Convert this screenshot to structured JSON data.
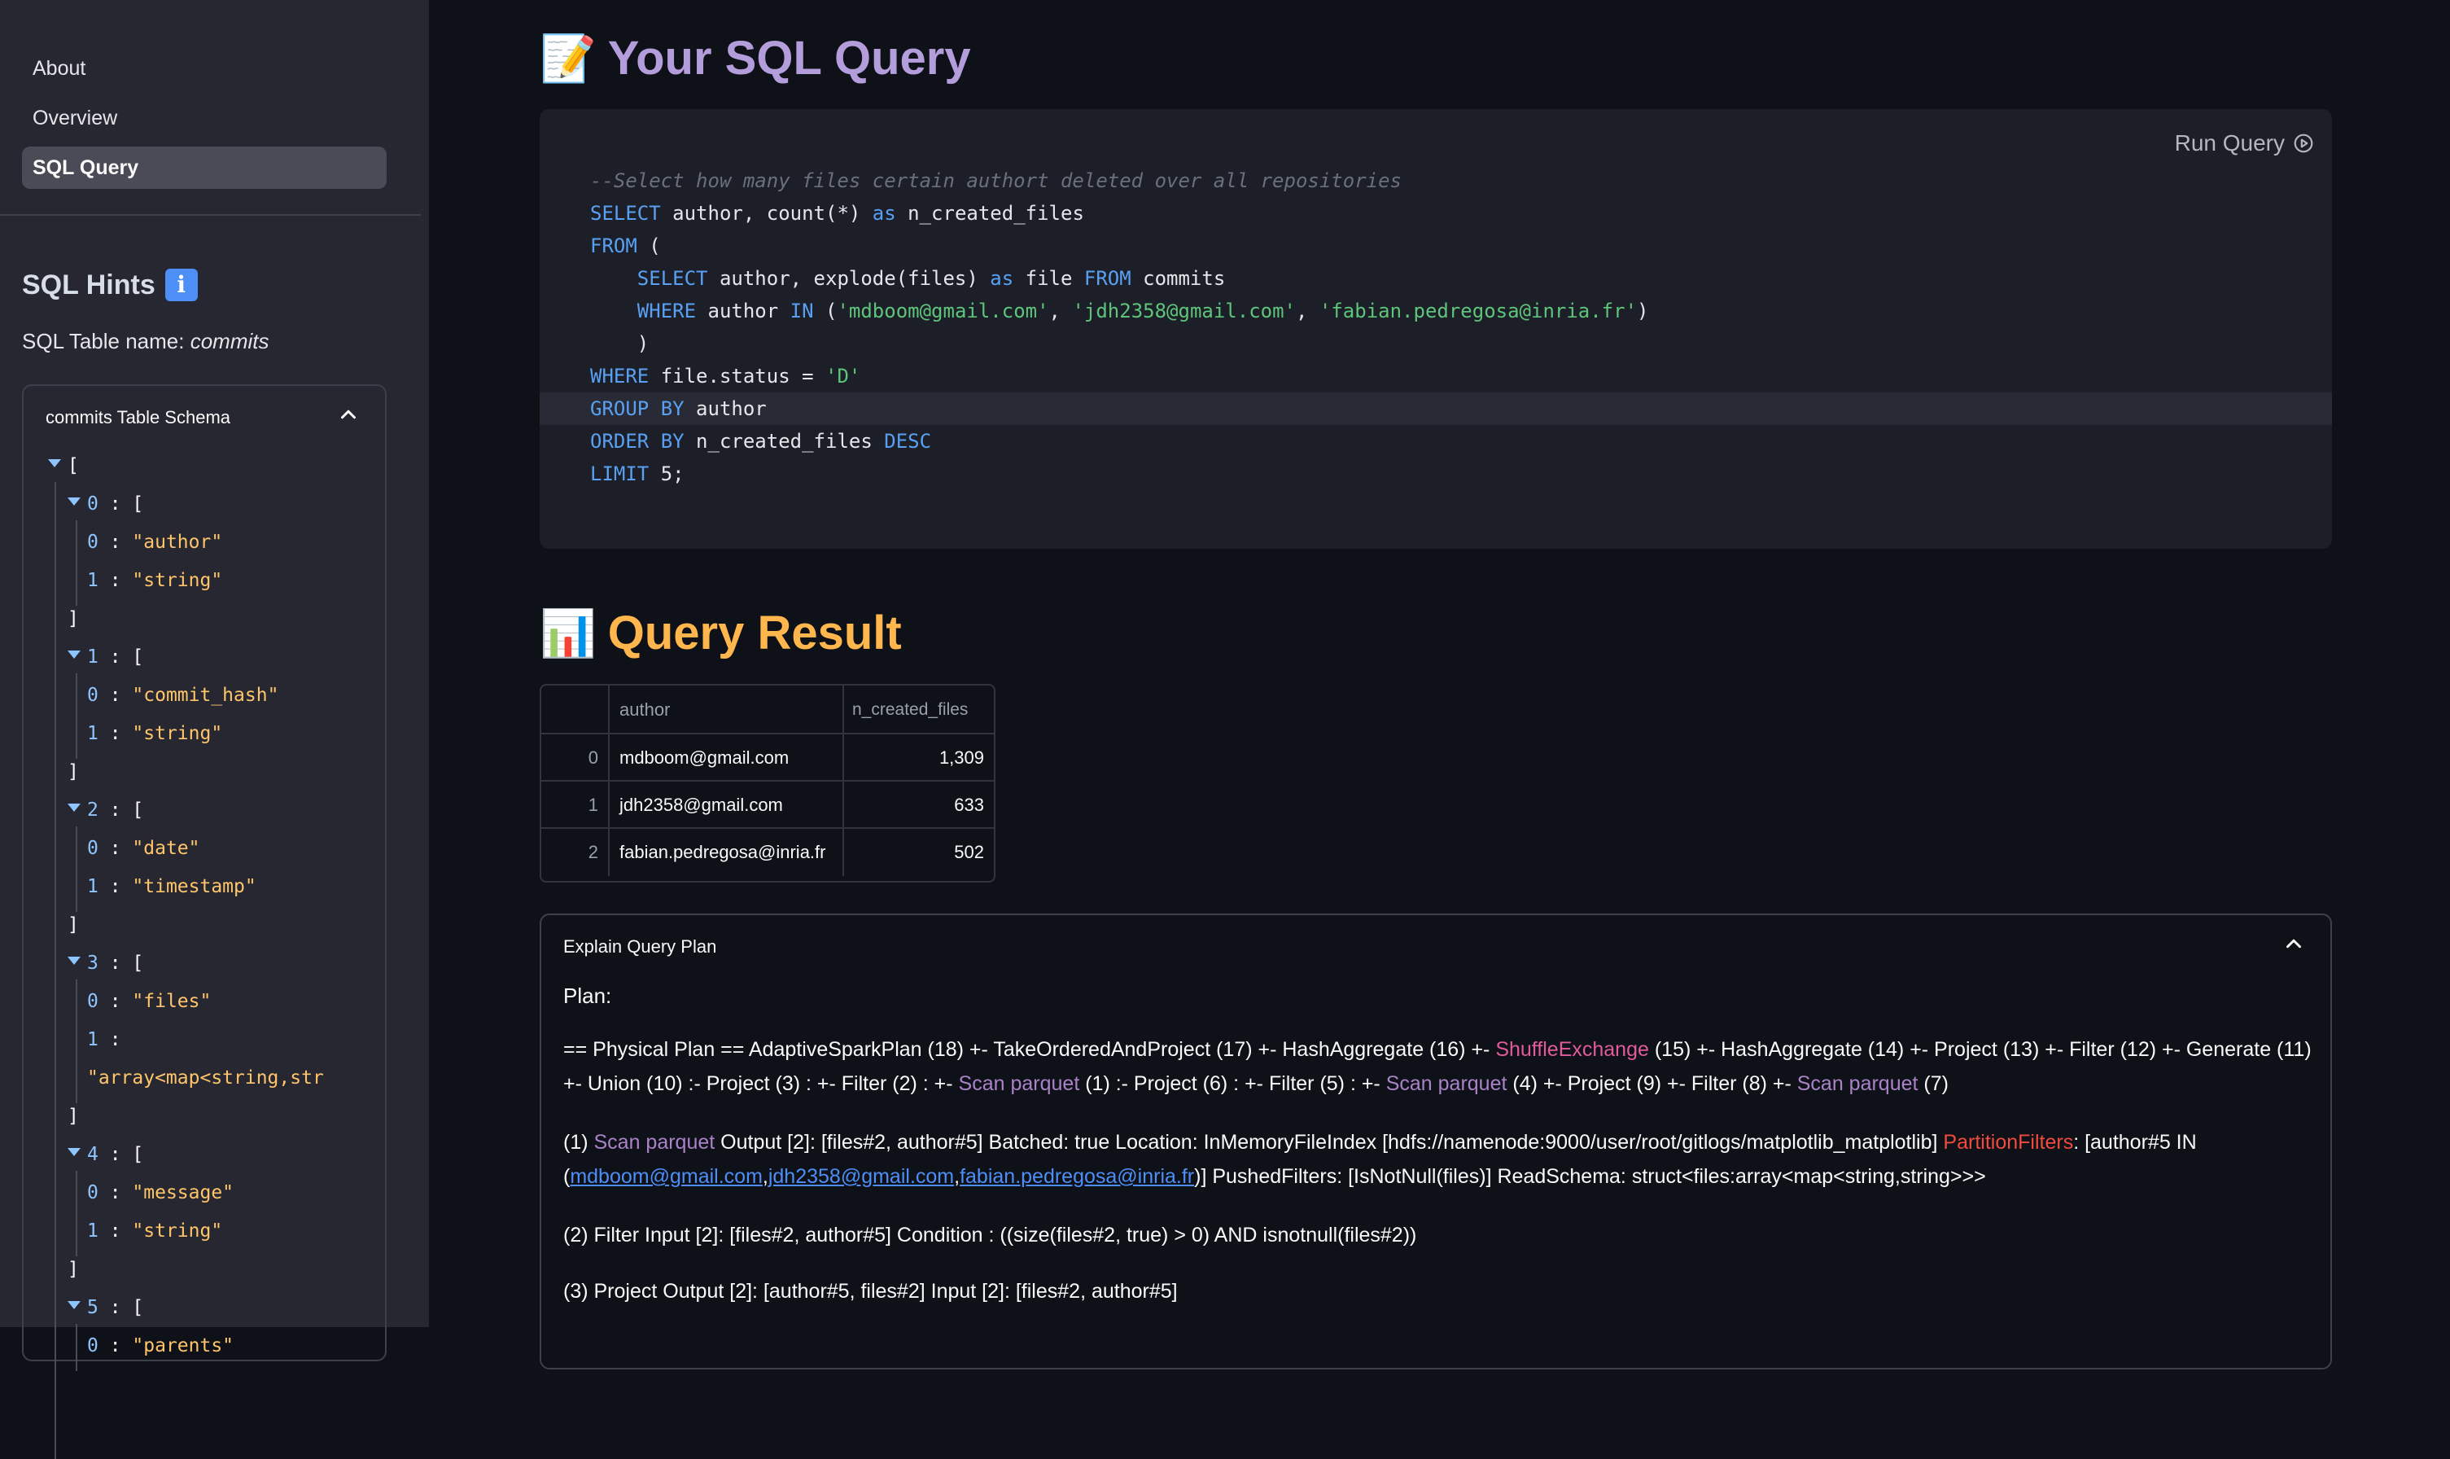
{
  "sidebar": {
    "nav": [
      "About",
      "Overview",
      "SQL Query"
    ],
    "active": "SQL Query",
    "hints_title": "SQL Hints",
    "table_name_label": "SQL Table name:",
    "table_name": "commits",
    "schema_title": "commits Table Schema",
    "schema": [
      {
        "index": "0",
        "fields": [
          "\"author\"",
          "\"string\""
        ]
      },
      {
        "index": "1",
        "fields": [
          "\"commit_hash\"",
          "\"string\""
        ]
      },
      {
        "index": "2",
        "fields": [
          "\"date\"",
          "\"timestamp\""
        ]
      },
      {
        "index": "3",
        "fields": [
          "\"files\"",
          "\"array<map<string,str"
        ]
      },
      {
        "index": "4",
        "fields": [
          "\"message\"",
          "\"string\""
        ]
      },
      {
        "index": "5",
        "fields": [
          "\"parents\""
        ]
      }
    ]
  },
  "query": {
    "title": "Your SQL Query",
    "title_emoji": "📝",
    "run_label": "Run Query",
    "comment": "--Select how many files certain authort deleted over all repositories",
    "lines": [
      "SELECT author, count(*) as n_created_files",
      "FROM (",
      "    SELECT author, explode(files) as file FROM commits",
      "    WHERE author IN ('mdboom@gmail.com', 'jdh2358@gmail.com', 'fabian.pedregosa@inria.fr')",
      "    )",
      "WHERE file.status = 'D'",
      "GROUP BY author",
      "ORDER BY n_created_files DESC",
      "LIMIT 5;"
    ]
  },
  "result": {
    "title": "Query Result",
    "title_emoji": "📊",
    "columns": [
      "author",
      "n_created_files"
    ],
    "rows": [
      {
        "idx": "0",
        "author": "mdboom@gmail.com",
        "n": "1,309"
      },
      {
        "idx": "1",
        "author": "jdh2358@gmail.com",
        "n": "633"
      },
      {
        "idx": "2",
        "author": "fabian.pedregosa@inria.fr",
        "n": "502"
      }
    ]
  },
  "explain": {
    "title": "Explain Query Plan",
    "plan_label": "Plan:",
    "p1a": "== Physical Plan == AdaptiveSparkPlan (18) +- TakeOrderedAndProject (17) +- HashAggregate (16) +- ",
    "p1_shuffle": "ShuffleExchange",
    "p1b": " (15) +- HashAggregate (14) +- Project (13) +- Filter (12) +- Generate (11) +- Union (10) :- Project (3) : +- Filter (2) : +- ",
    "scan": "Scan parquet",
    "p1c": " (1) :- Project (6) : +- Filter (5) : +- ",
    "p1d": " (4) +- Project (9) +- Filter (8) +- ",
    "p1e": " (7)",
    "p2_num": "(1) ",
    "p2a": " Output [2]: [files#2, author#5] Batched: true Location: InMemoryFileIndex [hdfs://namenode:9000/user/root/gitlogs/matplotlib_matplotlib] ",
    "p2_partition": "PartitionFilters",
    "p2b": ": [author#5 IN (",
    "link1": "mdboom@gmail.com",
    "link2": "jdh2358@gmail.com",
    "link3": "fabian.pedregosa@inria.fr",
    "p2c": ")] PushedFilters: [IsNotNull(files)] ReadSchema: struct<files:array<map<string,string>>>",
    "p3": "(2) Filter Input [2]: [files#2, author#5] Condition : ((size(files#2, true) > 0) AND isnotnull(files#2))",
    "p4": "(3) Project Output [2]: [author#5, files#2] Input [2]: [files#2, author#5]"
  }
}
